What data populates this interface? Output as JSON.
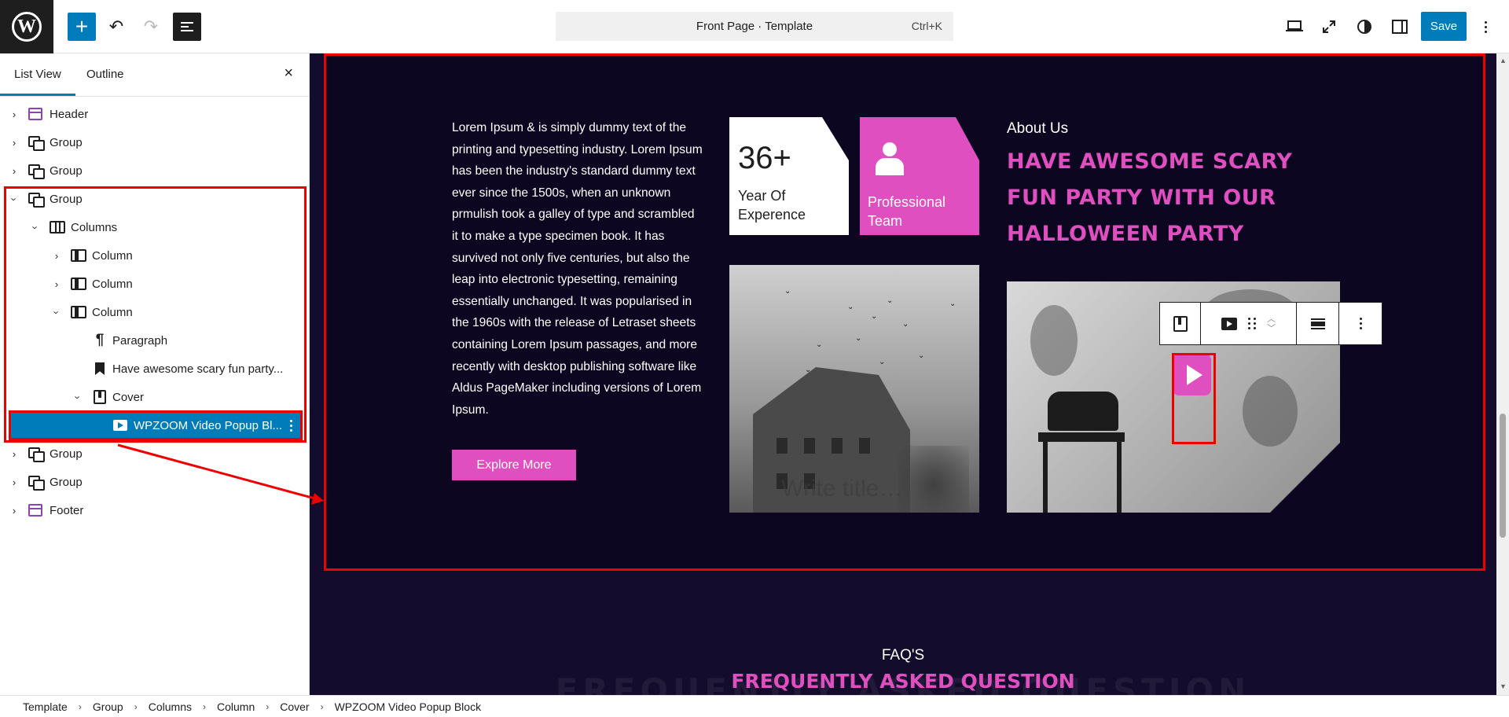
{
  "topbar": {
    "logo": "W",
    "add_label": "+",
    "undo": "↶",
    "redo": "↷",
    "command": {
      "title": "Front Page · Template",
      "shortcut": "Ctrl+K"
    },
    "save_label": "Save",
    "accent_color": "#007cba"
  },
  "sidebar": {
    "tabs": [
      "List View",
      "Outline"
    ],
    "close": "×",
    "tree": [
      {
        "label": "Header",
        "icon": "template-part-icon",
        "expanded": false
      },
      {
        "label": "Group",
        "icon": "group-icon",
        "expanded": false
      },
      {
        "label": "Group",
        "icon": "group-icon",
        "expanded": false
      },
      {
        "label": "Group",
        "icon": "group-icon",
        "expanded": true
      },
      {
        "label": "Columns",
        "icon": "columns-icon",
        "expanded": true
      },
      {
        "label": "Column",
        "icon": "column-icon",
        "expanded": false
      },
      {
        "label": "Column",
        "icon": "column-icon",
        "expanded": false
      },
      {
        "label": "Column",
        "icon": "column-icon",
        "expanded": true
      },
      {
        "label": "Paragraph",
        "icon": "paragraph-icon"
      },
      {
        "label": "Have awesome scary fun party...",
        "icon": "heading-bookmark-icon"
      },
      {
        "label": "Cover",
        "icon": "cover-icon",
        "expanded": true
      },
      {
        "label": "WPZOOM Video Popup Bl...",
        "icon": "video-popup-icon",
        "selected": true
      },
      {
        "label": "Group",
        "icon": "group-icon",
        "expanded": false
      },
      {
        "label": "Group",
        "icon": "group-icon",
        "expanded": false
      },
      {
        "label": "Footer",
        "icon": "template-part-icon",
        "expanded": false
      }
    ]
  },
  "canvas": {
    "lead_text": "Lorem Ipsum & is simply dummy text of the printing and typesetting industry. Lorem Ipsum has been the industry's standard dummy text ever since the 1500s, when an unknown prmulish took a galley of type and scrambled it to make a type specimen book. It has survived not only five centuries, but also the leap into electronic typesetting, remaining essentially unchanged. It was popularised in the 1960s with the release of Letraset sheets containing Lorem Ipsum passages, and more recently with desktop publishing software like Aldus PageMaker including versions of Lorem Ipsum.",
    "explore_label": "Explore More",
    "stat": {
      "number": "36+",
      "label": "Year Of Experence"
    },
    "team": {
      "label": "Professional Team"
    },
    "cover_placeholder": "Write title…",
    "about_label": "About Us",
    "about_heading": "Have awesome scary fun party with our halloween party",
    "faq_label": "FAQ'S",
    "faq_heading": "Frequently asked question",
    "faq_ghost": "FREQUENTLY ASKED QUESTION",
    "pink": "#e04fc0",
    "section_bg": "#0c0620"
  },
  "breadcrumb": [
    "Template",
    "Group",
    "Columns",
    "Column",
    "Cover",
    "WPZOOM Video Popup Block"
  ]
}
